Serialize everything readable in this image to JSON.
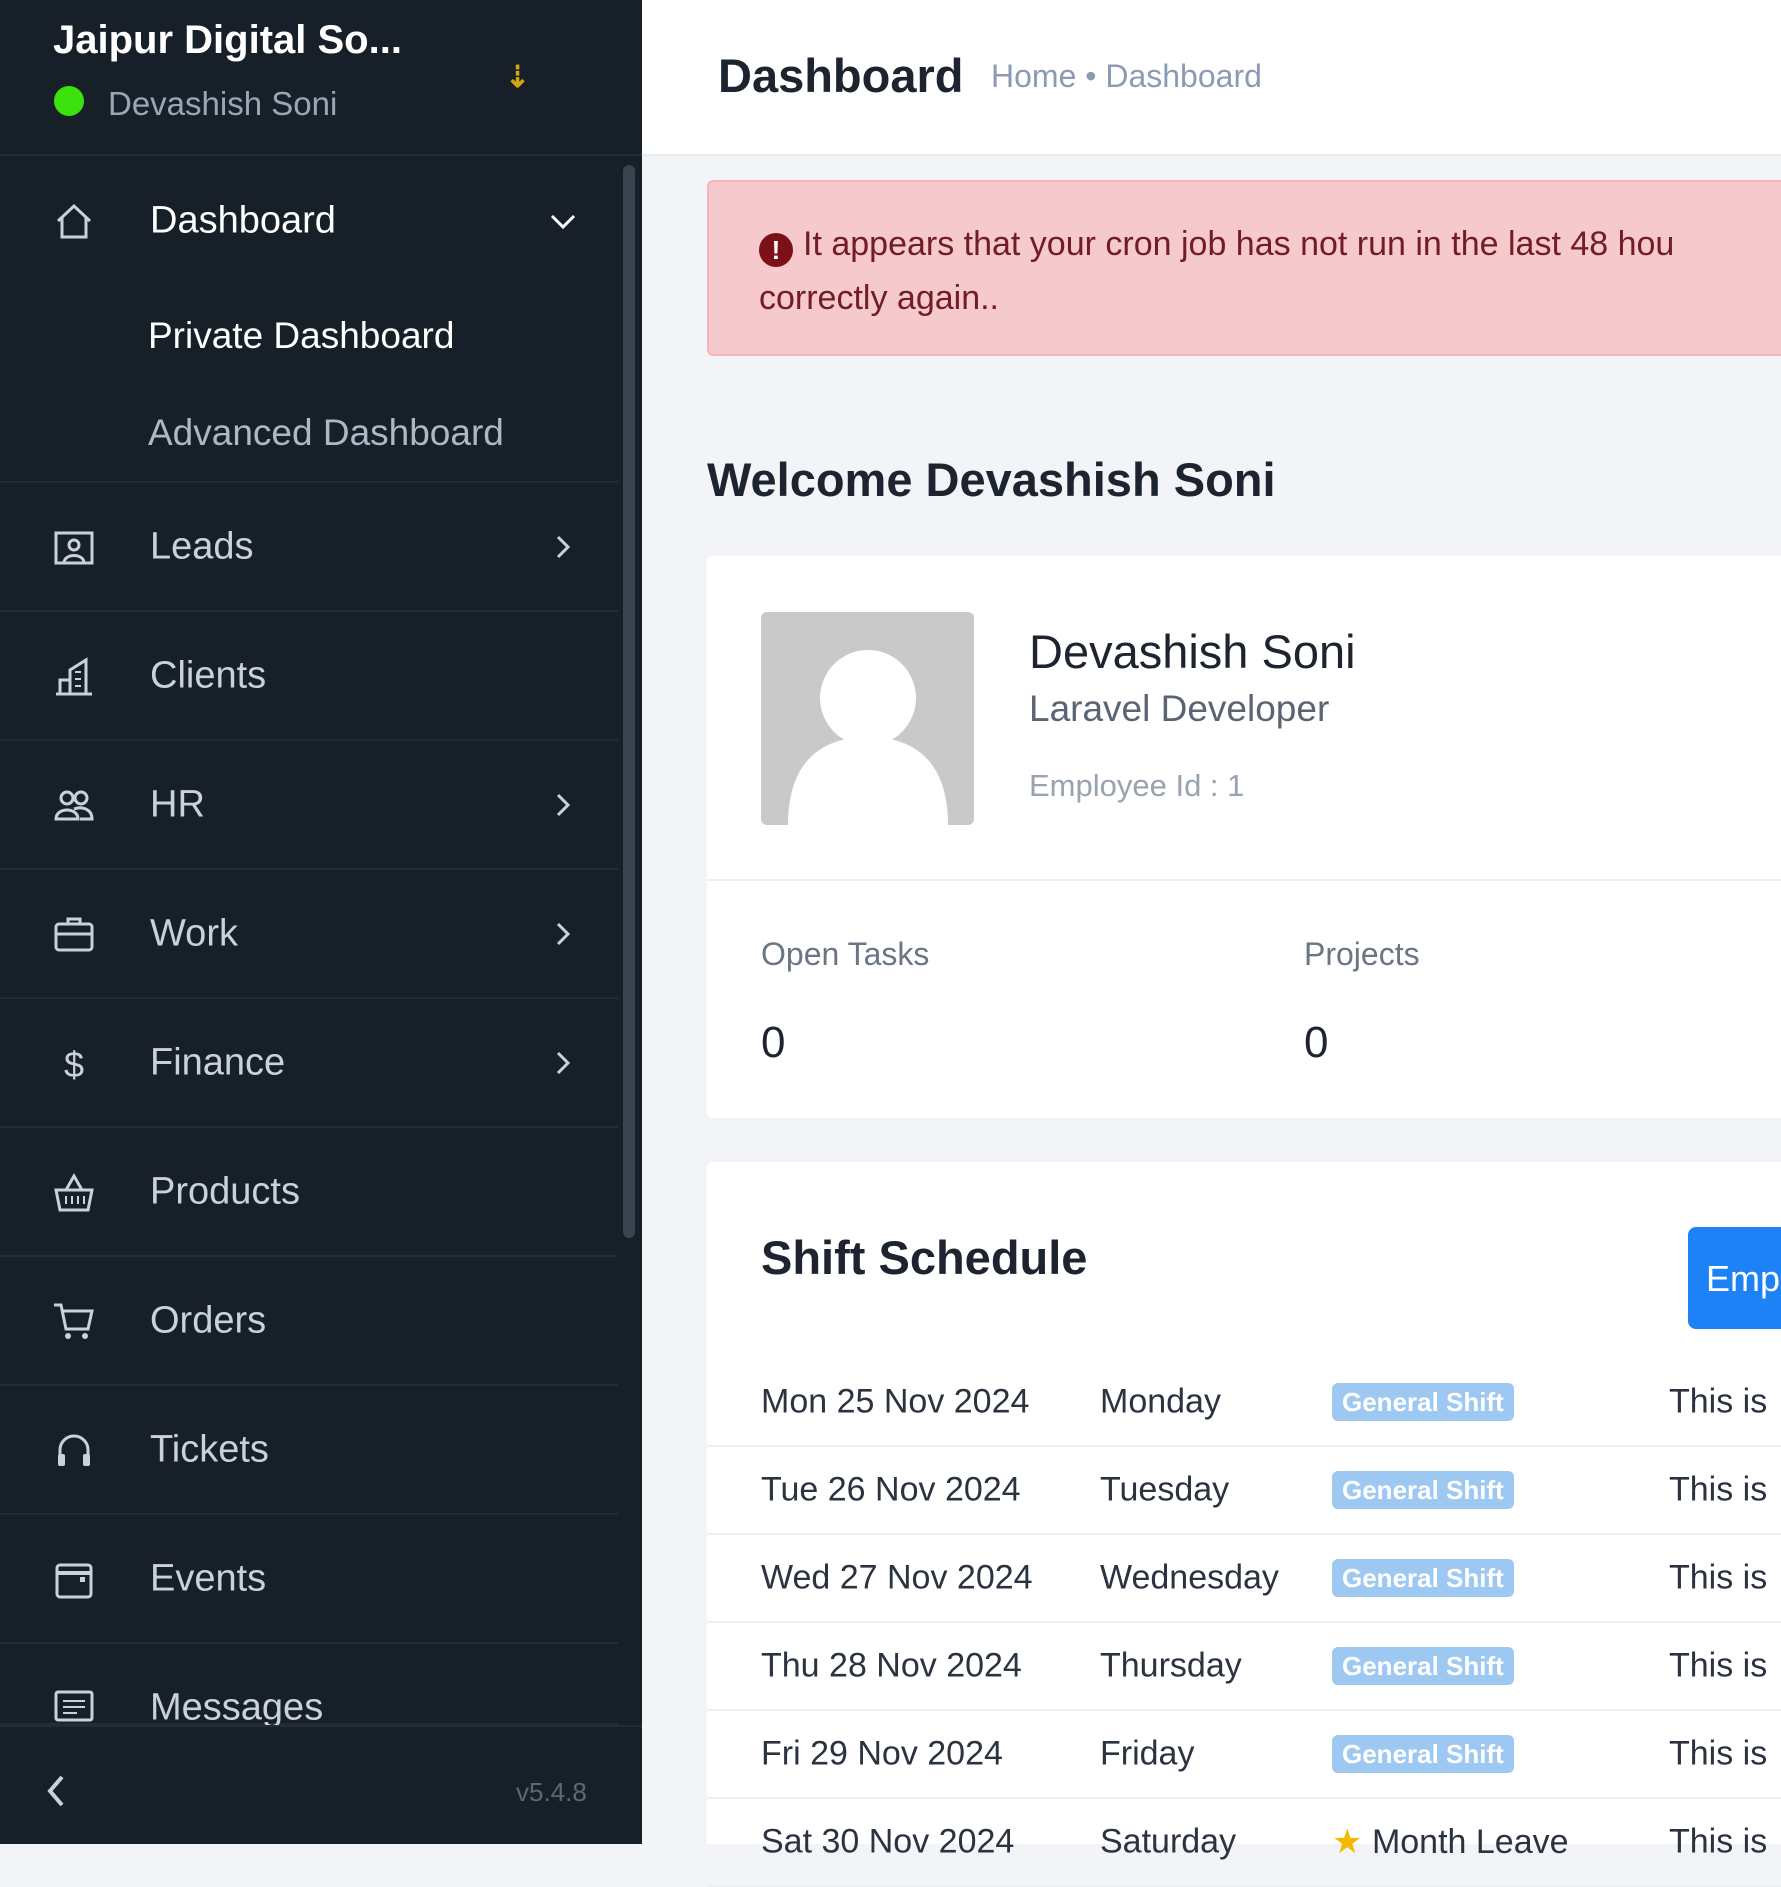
{
  "sidebar": {
    "company": "Jaipur Digital So...",
    "user": "Devashish Soni",
    "status_color": "#3be20c",
    "items": [
      {
        "label": "Dashboard",
        "icon": "home-icon",
        "chevron": "down"
      },
      {
        "label": "Leads",
        "icon": "leads-icon",
        "chevron": "right"
      },
      {
        "label": "Clients",
        "icon": "building-icon",
        "chevron": ""
      },
      {
        "label": "HR",
        "icon": "people-icon",
        "chevron": "right"
      },
      {
        "label": "Work",
        "icon": "briefcase-icon",
        "chevron": "right"
      },
      {
        "label": "Finance",
        "icon": "dollar-icon",
        "chevron": "right"
      },
      {
        "label": "Products",
        "icon": "basket-icon",
        "chevron": ""
      },
      {
        "label": "Orders",
        "icon": "cart-icon",
        "chevron": ""
      },
      {
        "label": "Tickets",
        "icon": "headset-icon",
        "chevron": ""
      },
      {
        "label": "Events",
        "icon": "calendar-icon",
        "chevron": ""
      },
      {
        "label": "Messages",
        "icon": "message-icon",
        "chevron": ""
      }
    ],
    "sub_items": [
      "Private Dashboard",
      "Advanced Dashboard"
    ],
    "version": "v5.4.8"
  },
  "header": {
    "title": "Dashboard",
    "breadcrumb": "Home • Dashboard"
  },
  "alert": {
    "line1": "It appears that your cron job has not run in the last 48 hou",
    "line2": "correctly again..",
    "icon": "exclamation-circle-icon"
  },
  "welcome": "Welcome Devashish Soni",
  "profile": {
    "name": "Devashish Soni",
    "role": "Laravel Developer",
    "employee_id": "Employee Id : 1",
    "stats": [
      {
        "label": "Open Tasks",
        "value": "0"
      },
      {
        "label": "Projects",
        "value": "0"
      }
    ]
  },
  "shift": {
    "title": "Shift Schedule",
    "button": "Emp",
    "accent": "#1d82f5",
    "rows": [
      {
        "date": "Mon 25 Nov 2024",
        "day": "Monday",
        "shift": "General Shift",
        "note": "This is"
      },
      {
        "date": "Tue 26 Nov 2024",
        "day": "Tuesday",
        "shift": "General Shift",
        "note": "This is"
      },
      {
        "date": "Wed 27 Nov 2024",
        "day": "Wednesday",
        "shift": "General Shift",
        "note": "This is"
      },
      {
        "date": "Thu 28 Nov 2024",
        "day": "Thursday",
        "shift": "General Shift",
        "note": "This is"
      },
      {
        "date": "Fri 29 Nov 2024",
        "day": "Friday",
        "shift": "General Shift",
        "note": "This is"
      },
      {
        "date": "Sat 30 Nov 2024",
        "day": "Saturday",
        "shift": "Month Leave",
        "note": "This is"
      }
    ]
  }
}
